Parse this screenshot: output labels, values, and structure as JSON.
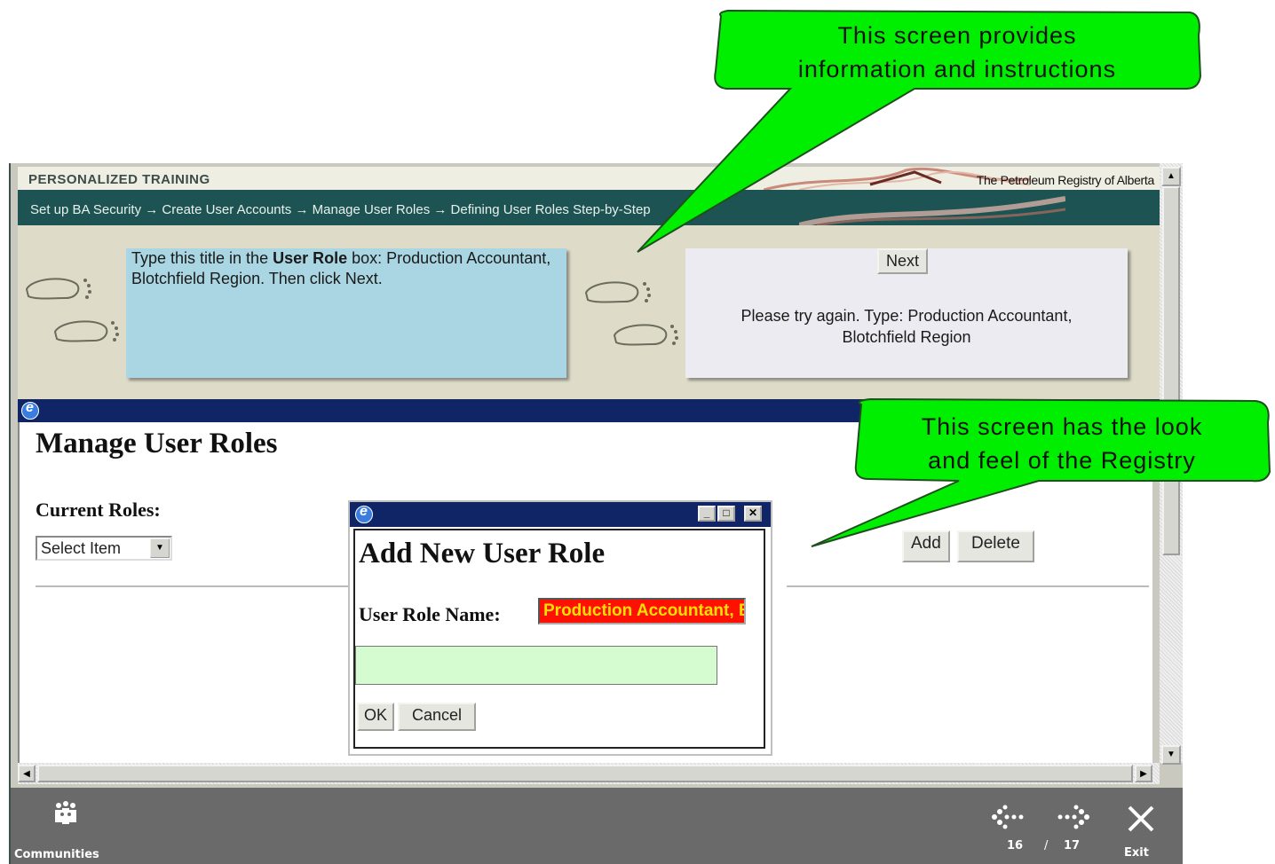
{
  "header": {
    "brand": "PERSONALIZED TRAINING",
    "org": "The Petroleum Registry of Alberta",
    "breadcrumb": "Set up BA Security → Create User Accounts → Manage User Roles → Defining User Roles Step-by-Step"
  },
  "instruction": {
    "text_before": "Type this title in the ",
    "bold": "User Role",
    "text_after": " box: Production Accountant, Blotchfield Region. Then click Next."
  },
  "feedback": {
    "next_label": "Next",
    "message_line1": "Please try again. Type: Production Accountant,",
    "message_line2": "Blotchfield Region"
  },
  "manage": {
    "title": "Manage User Roles",
    "current_roles_label": "Current Roles:",
    "select_value": "Select Item",
    "add_label": "Add",
    "delete_label": "Delete"
  },
  "dialog": {
    "title": "Add New User Role",
    "field_label": "User Role Name:",
    "field_value": "Production Accountant, Blotchfield Region",
    "ok_label": "OK",
    "cancel_label": "Cancel",
    "field_bg": "#ff1000",
    "field_fg": "#ffe000"
  },
  "toolbar": {
    "communities_label": "Communities",
    "page_current": "16",
    "page_sep": "/",
    "page_total": "17",
    "exit_label": "Exit"
  },
  "callouts": {
    "top_line1": "This screen provides",
    "top_line2": "information and instructions",
    "right_line1": "This screen has the look",
    "right_line2": "and feel of the Registry",
    "fill": "#00ee00"
  },
  "icons": [
    "footprints-icon",
    "ie-icon",
    "chevron-down-icon",
    "minimize-icon",
    "maximize-icon",
    "close-icon",
    "communities-icon",
    "back-arrow-icon",
    "forward-arrow-icon",
    "exit-x-icon"
  ]
}
